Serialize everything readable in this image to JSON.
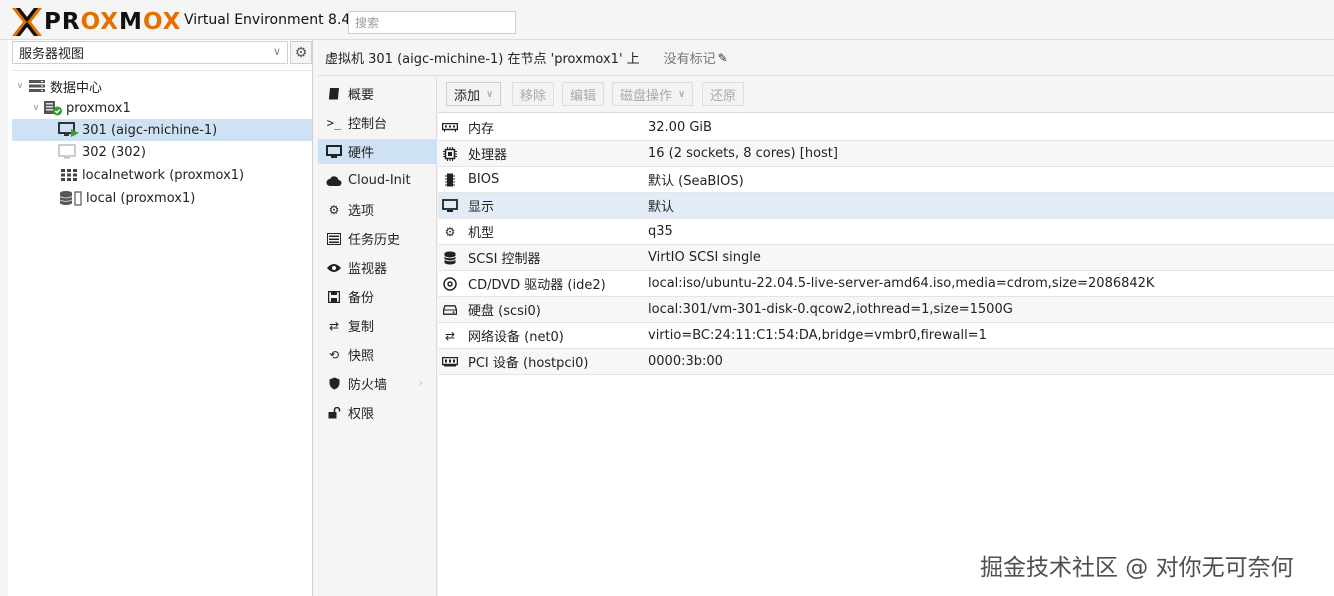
{
  "header": {
    "logo_prefix": "PR",
    "logo_ox": "OX",
    "logo_m": "M",
    "logo_ox2": "OX",
    "ve_title": "Virtual Environment 8.4.0",
    "search_placeholder": "搜索"
  },
  "left": {
    "view_label": "服务器视图",
    "tree": [
      {
        "label": "数据中心",
        "icon": "datacenter-icon"
      },
      {
        "label": "proxmox1",
        "icon": "node-online-icon"
      },
      {
        "label": "301 (aigc-michine-1)",
        "icon": "vm-running-icon"
      },
      {
        "label": "302 (302)",
        "icon": "vm-stopped-icon"
      },
      {
        "label": "localnetwork (proxmox1)",
        "icon": "network-grid-icon"
      },
      {
        "label": "local (proxmox1)",
        "icon": "storage-icon"
      }
    ]
  },
  "breadcrumb": {
    "title": "虚拟机 301 (aigc-michine-1) 在节点 'proxmox1' 上",
    "tag_label": "没有标记"
  },
  "nav": [
    {
      "label": "概要",
      "icon": "book-icon"
    },
    {
      "label": "控制台",
      "icon": "terminal-icon"
    },
    {
      "label": "硬件",
      "icon": "monitor-icon"
    },
    {
      "label": "Cloud-Init",
      "icon": "cloud-icon"
    },
    {
      "label": "选项",
      "icon": "gear-icon"
    },
    {
      "label": "任务历史",
      "icon": "list-icon"
    },
    {
      "label": "监视器",
      "icon": "eye-icon"
    },
    {
      "label": "备份",
      "icon": "floppy-icon"
    },
    {
      "label": "复制",
      "icon": "retweet-icon"
    },
    {
      "label": "快照",
      "icon": "history-icon"
    },
    {
      "label": "防火墙",
      "icon": "shield-icon"
    },
    {
      "label": "权限",
      "icon": "unlock-icon"
    }
  ],
  "toolbar": {
    "add": "添加",
    "remove": "移除",
    "edit": "编辑",
    "disk_action": "磁盘操作",
    "revert": "还原"
  },
  "hardware": [
    {
      "name": "内存",
      "value": "32.00 GiB",
      "icon": "memory-icon"
    },
    {
      "name": "处理器",
      "value": "16 (2 sockets, 8 cores) [host]",
      "icon": "cpu-icon"
    },
    {
      "name": "BIOS",
      "value": "默认 (SeaBIOS)",
      "icon": "microchip-icon"
    },
    {
      "name": "显示",
      "value": "默认",
      "icon": "desktop-icon"
    },
    {
      "name": "机型",
      "value": "q35",
      "icon": "cogs-icon"
    },
    {
      "name": "SCSI 控制器",
      "value": "VirtIO SCSI single",
      "icon": "database-icon"
    },
    {
      "name": "CD/DVD 驱动器 (ide2)",
      "value": "local:iso/ubuntu-22.04.5-live-server-amd64.iso,media=cdrom,size=2086842K",
      "icon": "cdrom-icon"
    },
    {
      "name": "硬盘 (scsi0)",
      "value": "local:301/vm-301-disk-0.qcow2,iothread=1,size=1500G",
      "icon": "hdd-icon"
    },
    {
      "name": "网络设备 (net0)",
      "value": "virtio=BC:24:11:C1:54:DA,bridge=vmbr0,firewall=1",
      "icon": "exchange-icon"
    },
    {
      "name": "PCI 设备 (hostpci0)",
      "value": "0000:3b:00",
      "icon": "pci-card-icon"
    }
  ],
  "watermark": "掘金技术社区 @ 对你无可奈何",
  "colors": {
    "accent": "#e57000",
    "selection": "#cfe2f5"
  }
}
